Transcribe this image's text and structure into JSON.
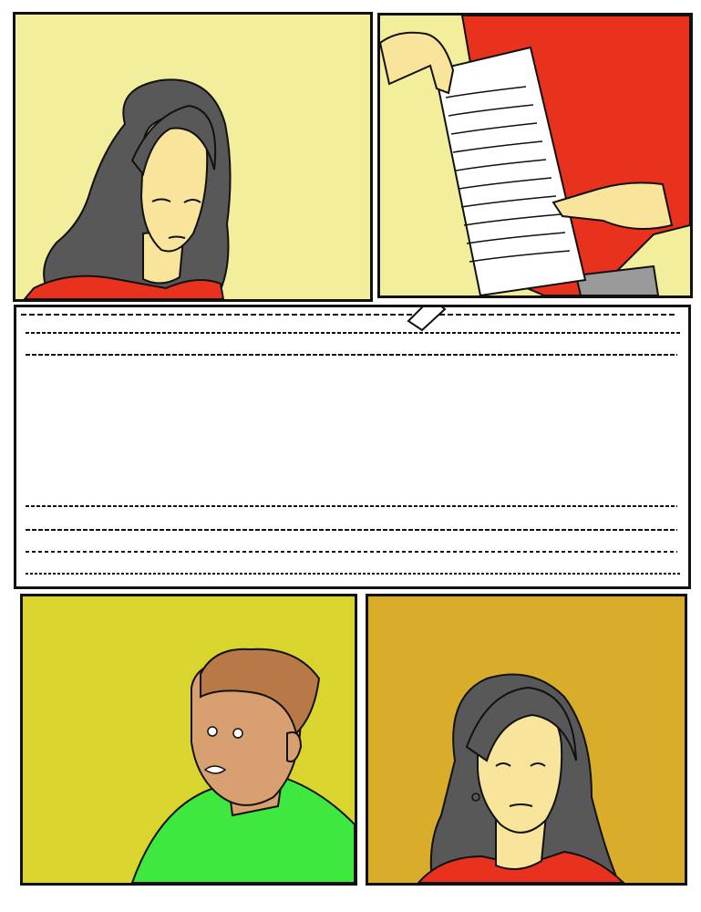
{
  "comic": {
    "panel_count": 5,
    "colors": {
      "panel1_bg": "#f2ee9c",
      "panel2_bg": "#f2ee9c",
      "panel3_bg": "#ffffff",
      "panel4_bg": "#d9d52e",
      "panel5_bg": "#d9ad2a",
      "hair": "#585858",
      "skin_woman": "#f8e49a",
      "skin_man": "#d8a070",
      "hair_man": "#b87848",
      "red_top": "#e8321e",
      "green_shirt": "#3ee83e",
      "outline": "#111111"
    },
    "panels": [
      {
        "name": "woman-portrait-panel"
      },
      {
        "name": "document-held-panel"
      },
      {
        "name": "document-closeup-panel"
      },
      {
        "name": "man-reaction-panel"
      },
      {
        "name": "woman-closeup-panel"
      }
    ]
  }
}
